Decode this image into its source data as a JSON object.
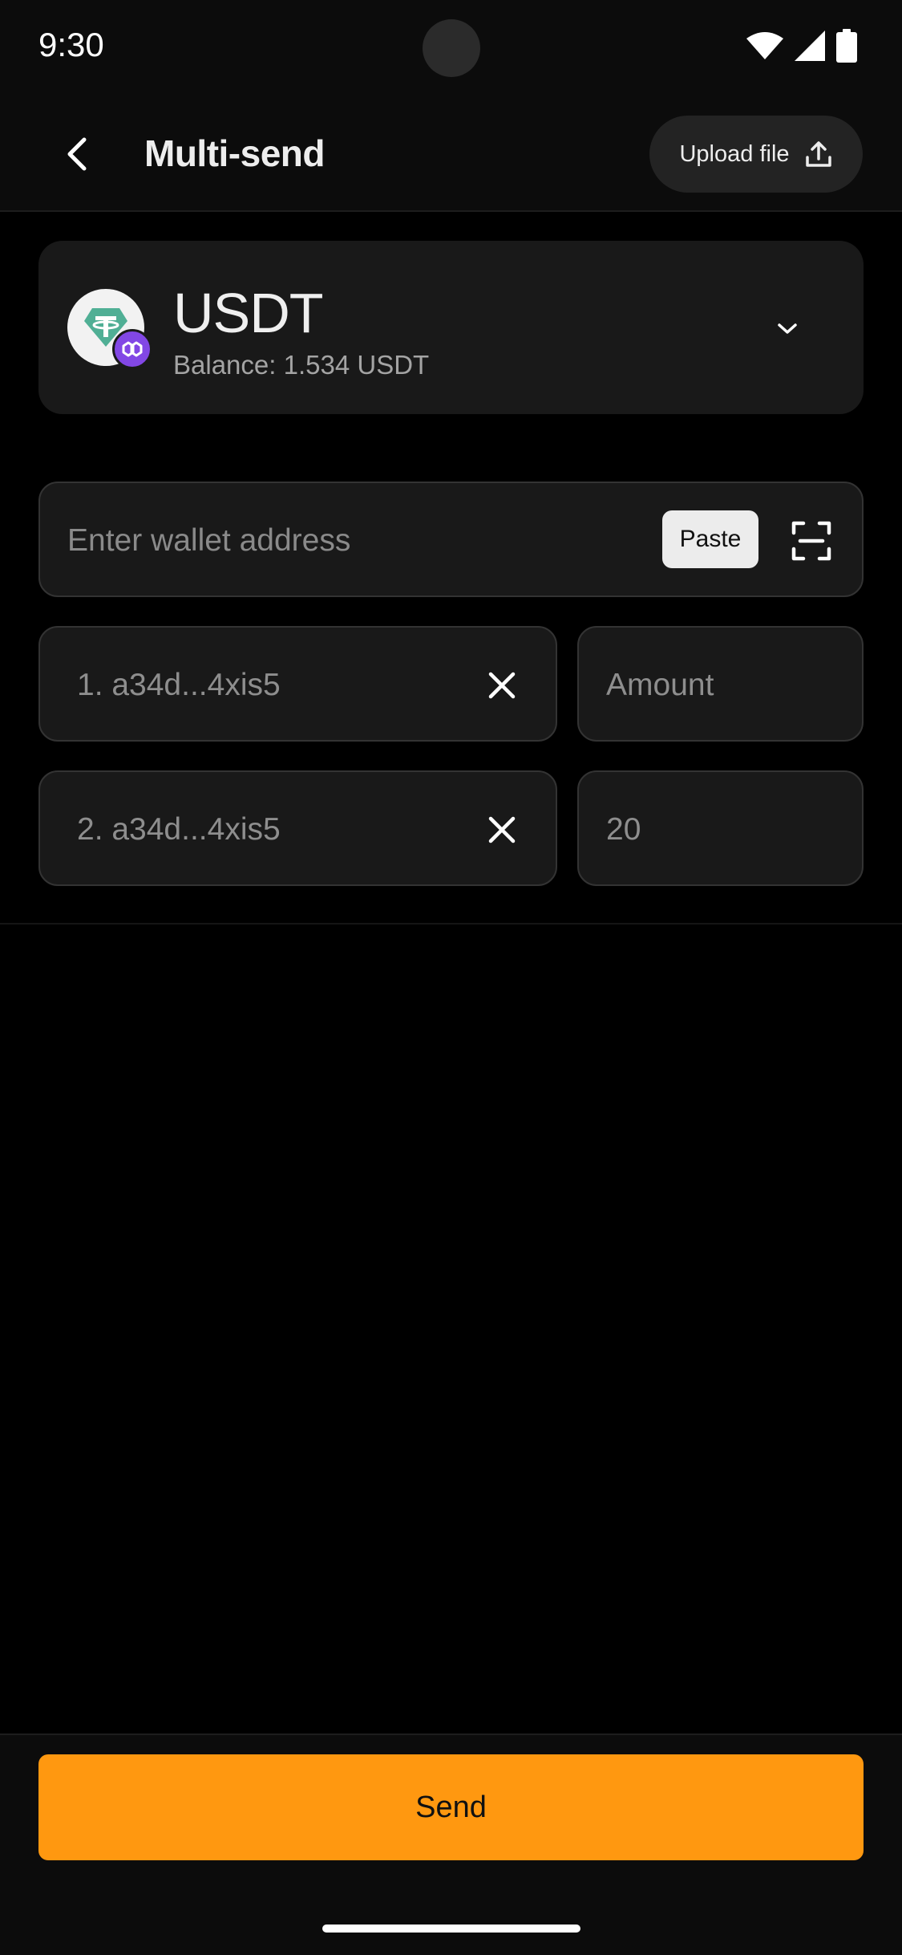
{
  "status_bar": {
    "time": "9:30",
    "icons": [
      "wifi-icon",
      "cellular-signal-icon",
      "battery-icon"
    ]
  },
  "header": {
    "title": "Multi-send",
    "back_icon": "chevron-left-icon",
    "upload_label": "Upload file",
    "upload_icon": "upload-icon"
  },
  "token": {
    "symbol": "USDT",
    "balance_label": "Balance:",
    "balance_value": "1.534 USDT",
    "logo_icon": "tether-icon",
    "chain_icon": "polygon-icon",
    "chevron_icon": "chevron-down-icon"
  },
  "address_input": {
    "placeholder": "Enter wallet address",
    "paste_label": "Paste",
    "scan_icon": "scan-qr-icon"
  },
  "recipients": [
    {
      "address": "1. a34d...4xis5",
      "amount": "Amount",
      "amount_is_placeholder": true
    },
    {
      "address": "2. a34d...4xis5",
      "amount": "20",
      "amount_is_placeholder": false
    }
  ],
  "footer": {
    "send_label": "Send"
  },
  "colors": {
    "accent": "#ff9810",
    "background": "#000000",
    "surface": "#191919",
    "border": "#333333",
    "tether_green": "#50af95",
    "polygon_purple": "#8247e5"
  }
}
